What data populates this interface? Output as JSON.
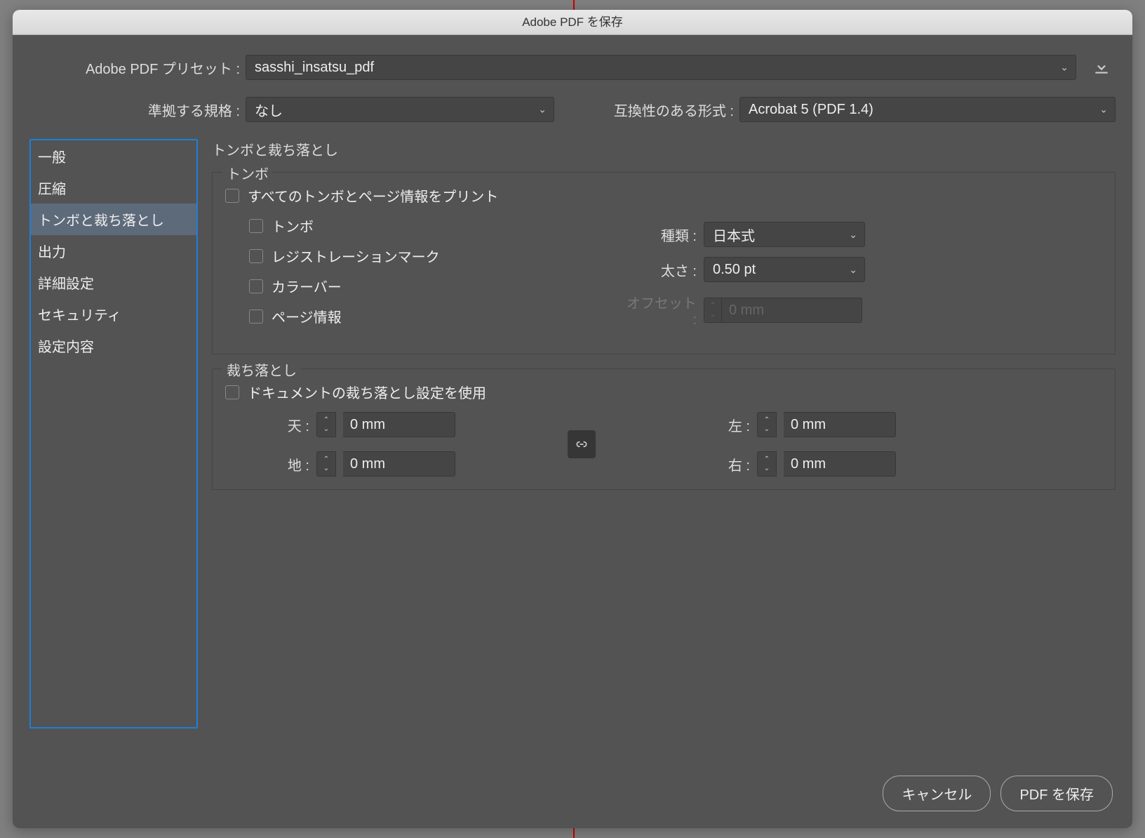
{
  "title": "Adobe PDF を保存",
  "preset": {
    "label": "Adobe PDF プリセット :",
    "value": "sasshi_insatsu_pdf"
  },
  "standard": {
    "label": "準拠する規格 :",
    "value": "なし"
  },
  "compat": {
    "label": "互換性のある形式 :",
    "value": "Acrobat 5 (PDF 1.4)"
  },
  "sidebar": {
    "items": [
      "一般",
      "圧縮",
      "トンボと裁ち落とし",
      "出力",
      "詳細設定",
      "セキュリティ",
      "設定内容"
    ],
    "selected": 2
  },
  "panel": {
    "title": "トンボと裁ち落とし",
    "marks": {
      "legend": "トンボ",
      "all": "すべてのトンボとページ情報をプリント",
      "items": [
        "トンボ",
        "レジストレーションマーク",
        "カラーバー",
        "ページ情報"
      ],
      "type": {
        "label": "種類 :",
        "value": "日本式"
      },
      "weight": {
        "label": "太さ :",
        "value": "0.50 pt"
      },
      "offset": {
        "label": "オフセット :",
        "value": "0 mm"
      }
    },
    "bleed": {
      "legend": "裁ち落とし",
      "useDoc": "ドキュメントの裁ち落とし設定を使用",
      "top": {
        "label": "天 :",
        "value": "0 mm"
      },
      "bottom": {
        "label": "地 :",
        "value": "0 mm"
      },
      "left": {
        "label": "左 :",
        "value": "0 mm"
      },
      "right": {
        "label": "右 :",
        "value": "0 mm"
      }
    }
  },
  "buttons": {
    "cancel": "キャンセル",
    "save": "PDF を保存"
  }
}
